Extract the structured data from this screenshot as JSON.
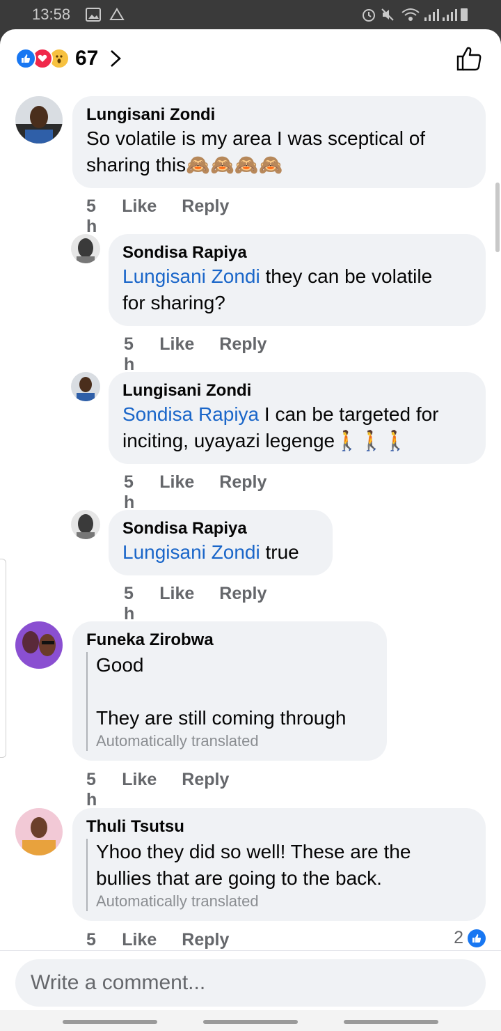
{
  "status": {
    "time": "13:58"
  },
  "reactions": {
    "count": "67"
  },
  "actions": {
    "time": "5 h",
    "like": "Like",
    "reply": "Reply"
  },
  "comments": [
    {
      "name": "Lungisani Zondi",
      "line1": "So volatile is my area I was sceptical of",
      "line2": "sharing this",
      "emoji": "🙈🙈🙈🙈"
    },
    {
      "name": "Sondisa Rapiya",
      "mention": "Lungisani Zondi",
      "line1": " they can be volatile",
      "line2": "for sharing?"
    },
    {
      "name": "Lungisani Zondi",
      "mention": "Sondisa Rapiya",
      "line1": " I can be targeted for",
      "line2": "inciting, uyayazi legenge",
      "emoji": "🚶🚶🚶"
    },
    {
      "name": "Sondisa Rapiya",
      "mention": "Lungisani Zondi",
      "line1": " true"
    },
    {
      "name": "Funeka Zirobwa",
      "line1": "Good",
      "line2": "They are still coming through",
      "translated": "Automatically translated"
    },
    {
      "name": "Thuli Tsutsu",
      "line1": "Yhoo they did so well! These are the",
      "line2": "bullies that are going to the back.",
      "translated": "Automatically translated",
      "likes": "2"
    }
  ],
  "composer": {
    "placeholder": "Write a comment..."
  },
  "colors": {
    "like_blue": "#1877f2",
    "mention_blue": "#1a66c9",
    "bubble": "#f0f2f5"
  },
  "icons": [
    "like-reaction-icon",
    "love-reaction-icon",
    "wow-reaction-icon",
    "chevron-right-icon",
    "thumbs-up-outline-icon"
  ]
}
